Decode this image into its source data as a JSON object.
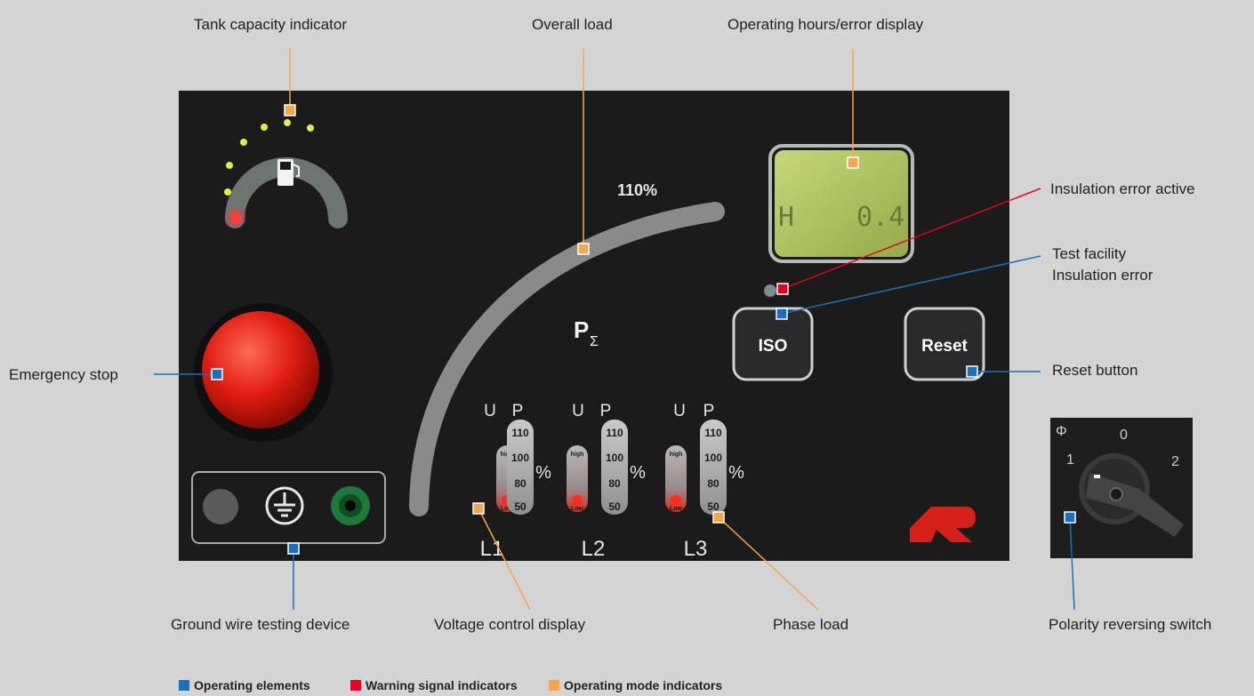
{
  "labels": {
    "tank": "Tank capacity indicator",
    "overall_load": "Overall load",
    "operating_hours": "Operating hours/error display",
    "insulation_active": "Insulation error active",
    "test_facility_1": "Test facility",
    "test_facility_2": "Insulation error",
    "reset_button": "Reset button",
    "emergency_stop": "Emergency stop",
    "polarity": "Polarity reversing switch",
    "ground_wire": "Ground wire testing device",
    "voltage_control": "Voltage control display",
    "phase_load": "Phase load"
  },
  "panel": {
    "overall_max": "110%",
    "p_sigma": "P",
    "sigma": "Σ",
    "lcd": {
      "left": "H",
      "right": "0.4"
    },
    "iso_label": "ISO",
    "reset_label": "Reset",
    "u_label": "U",
    "p_label": "P",
    "high": "high",
    "low": "Low",
    "pct": "%",
    "scale": [
      "110",
      "100",
      "80",
      "50"
    ],
    "phases": [
      "L1",
      "L2",
      "L3"
    ]
  },
  "switch": {
    "phi": "Φ",
    "pos0": "0",
    "pos1": "1",
    "pos2": "2"
  },
  "legend": {
    "operating_elements": "Operating elements",
    "warning_signal": "Warning signal indicators",
    "operating_mode": "Operating mode indicators"
  },
  "colors": {
    "operating_elements": "#1a6fc1",
    "warning_signal": "#e3051b",
    "operating_mode": "#f3a64a"
  }
}
